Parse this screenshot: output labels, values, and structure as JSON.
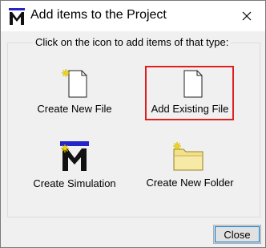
{
  "window": {
    "title": "Add items to the Project",
    "app_icon": "modelsim-m-icon",
    "close_icon": "close-icon"
  },
  "group": {
    "label": "Click on the icon to add items of that type:"
  },
  "items": [
    {
      "label": "Create New File",
      "icon": "new-file-icon"
    },
    {
      "label": "Add Existing File",
      "icon": "existing-file-icon",
      "selected": true
    },
    {
      "label": "Create Simulation",
      "icon": "simulation-icon"
    },
    {
      "label": "Create New Folder",
      "icon": "new-folder-icon"
    }
  ],
  "footer": {
    "close_label": "Close"
  },
  "colors": {
    "highlight_border": "#e02020",
    "focus_border": "#0078d7",
    "folder_yellow": "#f3e08a",
    "simulation_bar": "#2424c8"
  }
}
